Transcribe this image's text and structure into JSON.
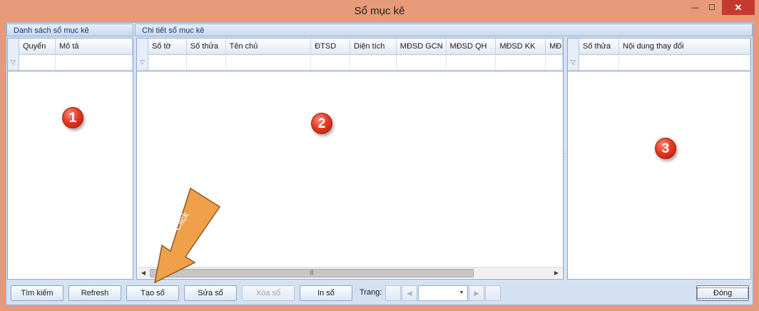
{
  "window": {
    "title": "Sổ mục kê",
    "minimize_glyph": "—",
    "maximize_glyph": "☐",
    "close_glyph": "✕"
  },
  "left_panel": {
    "title": "Danh sách sổ mục kê",
    "columns": [
      "Quyển",
      "Mô tả"
    ],
    "badge": "1"
  },
  "middle_panel": {
    "title": "Chi tiết sổ mục kê",
    "columns": [
      "Số tờ",
      "Số thửa",
      "Tên chủ",
      "ĐTSD",
      "Diện tích",
      "MĐSD GCN",
      "MĐSD QH",
      "MĐSD KK",
      "MĐ"
    ],
    "badge": "2"
  },
  "right_panel": {
    "columns": [
      "Số thửa",
      "Nội dung thay đổi"
    ],
    "badge": "3"
  },
  "toolbar": {
    "search_label": "Tìm kiếm",
    "refresh_label": "Refresh",
    "create_label": "Tạo sổ",
    "edit_label": "Sửa sổ",
    "delete_label": "Xóa sổ",
    "print_label": "In sổ",
    "page_label": "Trang:",
    "page_value": "",
    "close_label": "Đóng"
  },
  "annotation": {
    "arrow_text": "Click",
    "arrow_color": "#f0a04b"
  },
  "colors": {
    "frame": "#e79a7a",
    "client": "#d4e1f2",
    "close_button": "#c7392e",
    "badge": "#e33b25"
  }
}
